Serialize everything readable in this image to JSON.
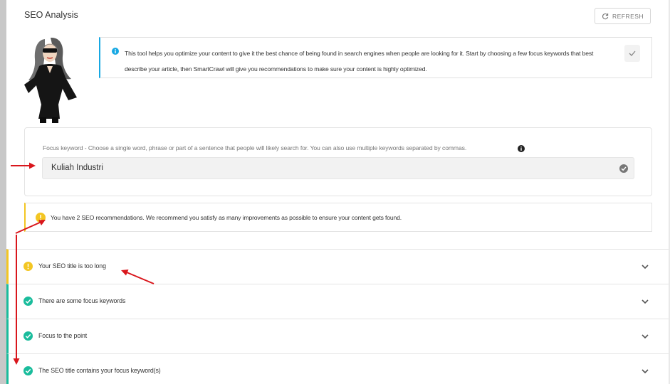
{
  "header": {
    "title": "SEO Analysis",
    "refresh_label": "REFRESH"
  },
  "info": {
    "text": "This tool helps you optimize your content to give it the best chance of being found in search engines when people are looking for it. Start by choosing a few focus keywords that best describe your article, then SmartCrawl will give you recommendations to make sure your content is highly optimized."
  },
  "focus": {
    "label": "Focus keyword - Choose a single word, phrase or part of a sentence that people will likely search for. You can also use multiple keywords separated by commas.",
    "value": "Kuliah Industri"
  },
  "notice": {
    "text": "You have 2 SEO recommendations. We recommend you satisfy as many improvements as possible to ensure your content gets found."
  },
  "recommendations": [
    {
      "label": "Your SEO title is too long",
      "status": "warning"
    },
    {
      "label": "There are some focus keywords",
      "status": "ok"
    },
    {
      "label": "Focus to the point",
      "status": "ok"
    },
    {
      "label": "The SEO title contains your focus keyword(s)",
      "status": "ok"
    }
  ],
  "colors": {
    "info_accent": "#17a8e3",
    "warning": "#f3c623",
    "success": "#1abc9c",
    "annotation_arrow": "#d9161c"
  },
  "icons": {
    "refresh": "refresh-icon",
    "info": "info-icon",
    "dismiss": "check-icon",
    "help": "help-icon",
    "valid": "check-circle-icon",
    "warning": "warning-dot-icon",
    "success": "success-check-icon",
    "expand": "chevron-down-icon"
  }
}
